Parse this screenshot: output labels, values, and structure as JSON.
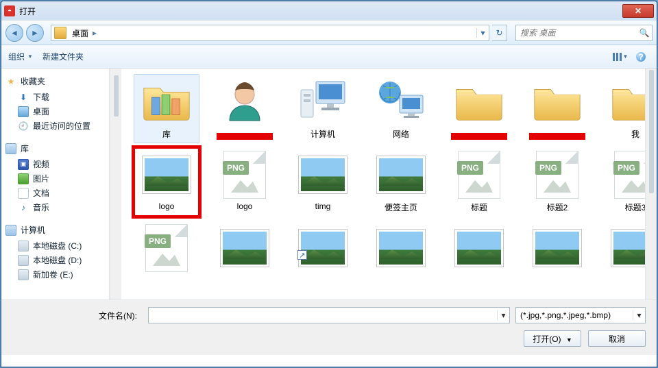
{
  "titlebar": {
    "title": "打开"
  },
  "nav": {
    "location_root": "桌面",
    "search_placeholder": "搜索 桌面"
  },
  "toolbar": {
    "organize": "组织",
    "newfolder": "新建文件夹"
  },
  "sidebar": {
    "favorites": {
      "head": "收藏夹",
      "items": [
        "下载",
        "桌面",
        "最近访问的位置"
      ]
    },
    "libraries": {
      "head": "库",
      "items": [
        "视频",
        "图片",
        "文档",
        "音乐"
      ]
    },
    "computer": {
      "head": "计算机",
      "items": [
        "本地磁盘 (C:)",
        "本地磁盘 (D:)",
        "新加卷 (E:)"
      ]
    }
  },
  "items_row1": [
    {
      "kind": "libs",
      "label": "库",
      "selected": true
    },
    {
      "kind": "user",
      "label": "",
      "redacted": true
    },
    {
      "kind": "pc",
      "label": "计算机"
    },
    {
      "kind": "net",
      "label": "网络"
    },
    {
      "kind": "folder",
      "label": "",
      "redacted": true
    },
    {
      "kind": "folder",
      "label": "",
      "redacted": true
    },
    {
      "kind": "folder",
      "label": "我"
    }
  ],
  "items_row2": [
    {
      "kind": "photo",
      "label": "logo",
      "highlight": true
    },
    {
      "kind": "png",
      "label": "logo"
    },
    {
      "kind": "photo",
      "label": "timg"
    },
    {
      "kind": "photo",
      "label": "便签主页"
    },
    {
      "kind": "png",
      "label": "标题"
    },
    {
      "kind": "png",
      "label": "标题2"
    },
    {
      "kind": "png",
      "label": "标题3"
    }
  ],
  "items_row3": [
    {
      "kind": "png",
      "label": ""
    },
    {
      "kind": "photo",
      "label": ""
    },
    {
      "kind": "photo",
      "label": "",
      "shortcut": true
    },
    {
      "kind": "photo",
      "label": ""
    },
    {
      "kind": "photo",
      "label": ""
    },
    {
      "kind": "photo",
      "label": ""
    },
    {
      "kind": "photo",
      "label": ""
    }
  ],
  "footer": {
    "filename_label": "文件名(N):",
    "filename_value": "",
    "filter": "(*.jpg,*.png,*.jpeg,*.bmp)",
    "open": "打开(O)",
    "cancel": "取消"
  },
  "png_badge": "PNG"
}
